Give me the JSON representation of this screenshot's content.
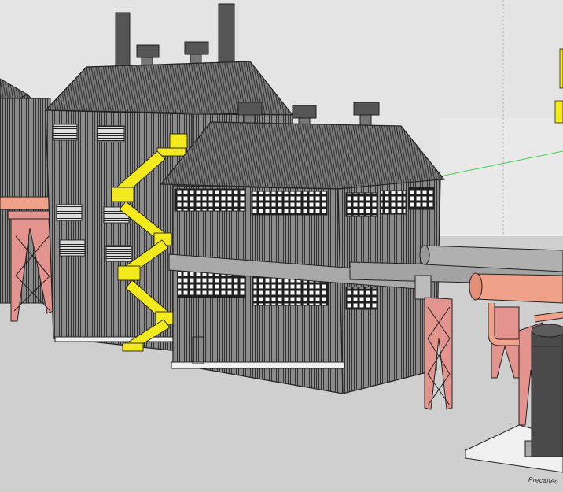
{
  "viewport": {
    "name": "3d-modeling-viewport",
    "colors": {
      "sky": "#e3e3e3",
      "ground": "#d0d0d0",
      "wall": "#7a7a7a",
      "roof": "#6d6d6d",
      "line": "#2a2a2a",
      "stair": "#f2ea1c",
      "trestle": "#e3948f",
      "pipe_gray": "#a9a9a9",
      "pipe_salmon": "#f0a18a",
      "axis_green": "#3ed04a",
      "tank": "#4a4a4a"
    }
  },
  "scene": {
    "objects": [
      "rear-warehouse",
      "tall-building",
      "tall-building-smokestack",
      "tall-building-roof-vents",
      "yellow-exterior-staircase",
      "front-building",
      "front-building-roof-vents",
      "gray-pipe-bridge",
      "pink-steel-trestle",
      "salmon-pipe",
      "storage-tank",
      "concrete-pad"
    ]
  },
  "watermark": {
    "text": "Precaitec"
  }
}
